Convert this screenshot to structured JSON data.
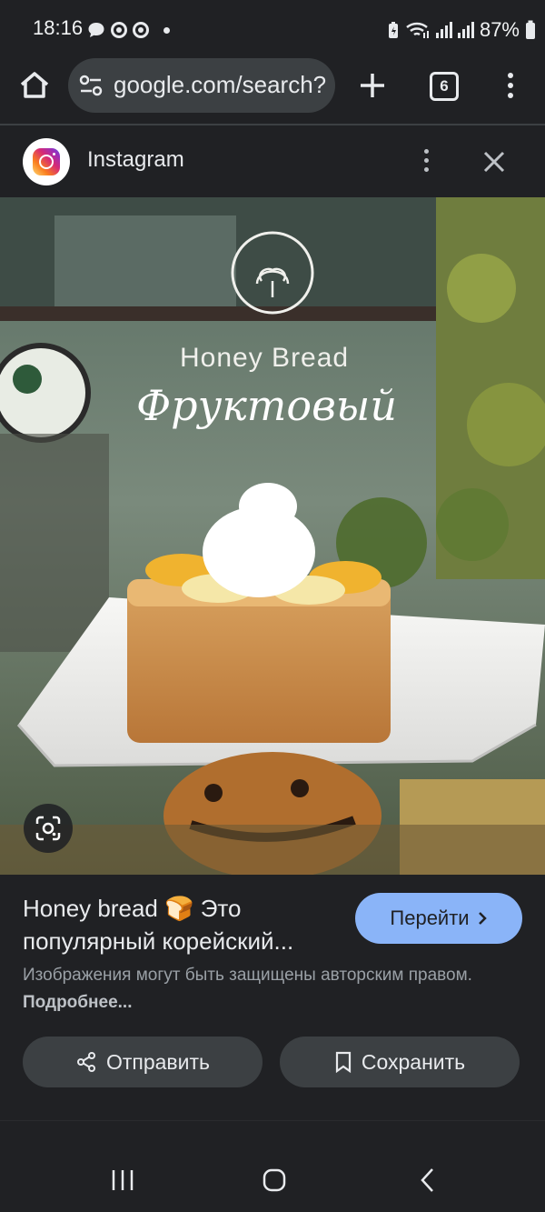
{
  "status_bar": {
    "time": "18:16",
    "battery": "87%"
  },
  "browser": {
    "url": "google.com/search?",
    "tab_count": "6"
  },
  "result": {
    "source": "Instagram",
    "image_text_line1": "Honey Bread",
    "image_text_line2": "Фруктовый",
    "title_line1": "Honey bread 🍞 Это",
    "title_line2": "популярный корейский...",
    "visit_label": "Перейти",
    "copyright_text": "Изображения могут быть защищены авторским правом.",
    "learn_more_label": "Подробнее...",
    "share_label": "Отправить",
    "save_label": "Сохранить"
  },
  "colors": {
    "background": "#202124",
    "accent_button": "#8ab4f8",
    "chip": "#3c4043"
  },
  "icons": [
    "home-icon",
    "tune-icon",
    "plus-icon",
    "tabs-icon",
    "more-vert-icon",
    "instagram-logo",
    "close-icon",
    "lens-icon",
    "share-icon",
    "bookmark-icon",
    "recents-icon",
    "home-nav-icon",
    "back-icon"
  ]
}
